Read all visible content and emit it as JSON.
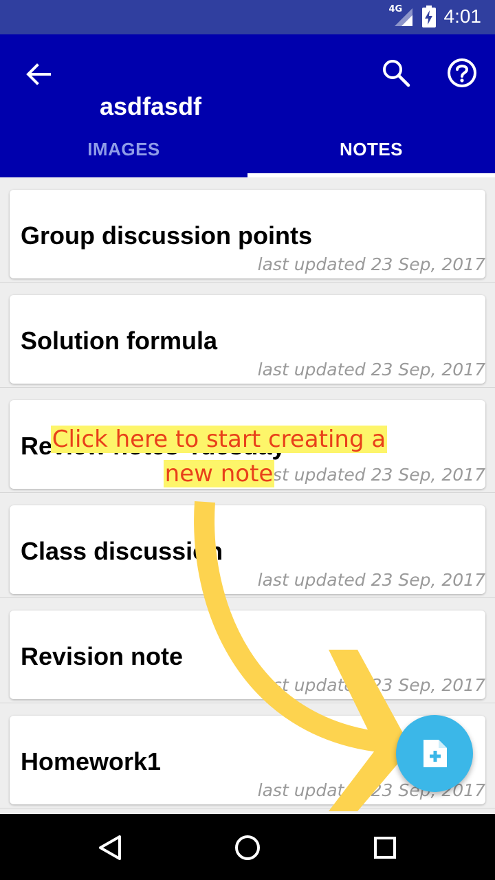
{
  "status_bar": {
    "network": "4G",
    "time": "4:01"
  },
  "app_bar": {
    "title": "asdfasdf",
    "back_icon": "arrow-back-icon",
    "search_icon": "search-icon",
    "help_icon": "help-icon"
  },
  "tabs": [
    {
      "label": "IMAGES",
      "selected": false
    },
    {
      "label": "NOTES",
      "selected": true
    }
  ],
  "notes": [
    {
      "title": "Group discussion points",
      "updated": "last updated 23 Sep, 2017"
    },
    {
      "title": "Solution formula",
      "updated": "last updated 23 Sep, 2017"
    },
    {
      "title": "Review notes-Tuesday",
      "updated": "last updated 23 Sep, 2017"
    },
    {
      "title": "Class discussion",
      "updated": "last updated 23 Sep, 2017"
    },
    {
      "title": "Revision note",
      "updated": "last updated 23 Sep, 2017"
    },
    {
      "title": "Homework1",
      "updated": "last updated 23 Sep, 2017"
    }
  ],
  "overlay": {
    "line1": "Click here to start creating a",
    "line2": "new note",
    "text_color": "#e8401a",
    "highlight_color": "#fdf56a",
    "arrow_color": "#fdd34f"
  },
  "fab": {
    "icon": "new-note-icon",
    "color": "#3bb7e8"
  },
  "colors": {
    "app_bar": "#0000ad",
    "status_bar": "#303f9f"
  }
}
